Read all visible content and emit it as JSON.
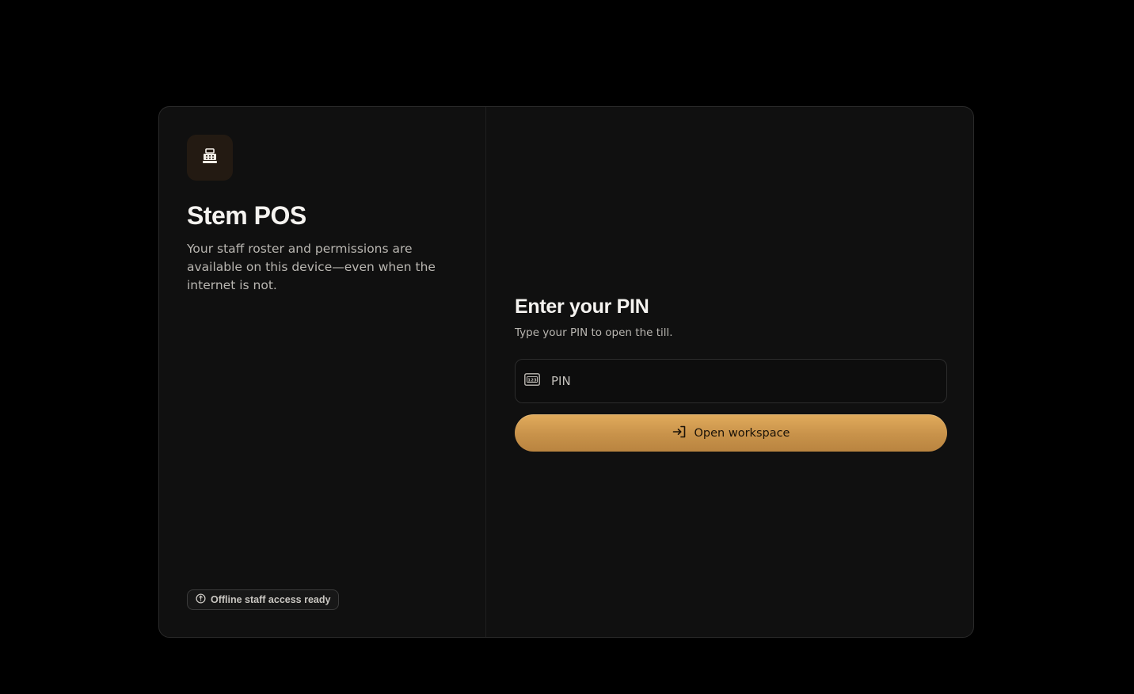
{
  "brand": {
    "title": "Stem POS",
    "description": "Your staff roster and permissions are available on this device—even when the internet is not.",
    "icon": "cash-register-icon"
  },
  "status_badge": {
    "label": "Offline staff access ready",
    "icon": "status-circle-icon"
  },
  "pin_form": {
    "title": "Enter your PIN",
    "subtitle": "Type your PIN to open the till.",
    "pin_placeholder": "PIN",
    "pin_value": "",
    "field_icon": "numeric-keypad-icon",
    "submit_label": "Open workspace",
    "submit_icon": "sign-in-icon"
  },
  "colors": {
    "accent": "#d19a50",
    "background": "#000000",
    "card": "#101010"
  }
}
